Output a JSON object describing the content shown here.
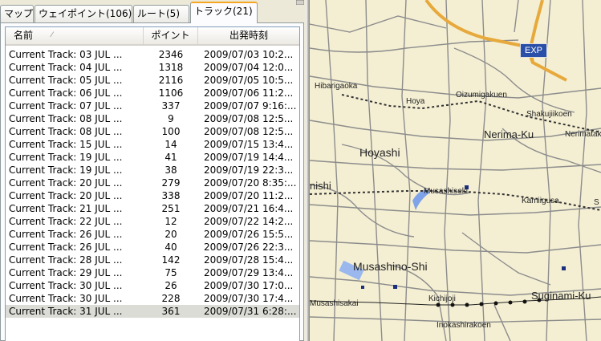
{
  "tabs": [
    {
      "label": "マップ",
      "active": false
    },
    {
      "label": "ウェイポイント(106)",
      "active": false
    },
    {
      "label": "ルート(5)",
      "active": false
    },
    {
      "label": "トラック(21)",
      "active": true
    }
  ],
  "list": {
    "columns": {
      "name": "名前",
      "points": "ポイント",
      "time": "出発時刻"
    },
    "rows": [
      {
        "name": "Current Track: 03 JUL ...",
        "points": "2346",
        "time": "2009/07/03 10:2..."
      },
      {
        "name": "Current Track: 04 JUL ...",
        "points": "1318",
        "time": "2009/07/04 12:0..."
      },
      {
        "name": "Current Track: 05 JUL ...",
        "points": "2116",
        "time": "2009/07/05 10:5..."
      },
      {
        "name": "Current Track: 06 JUL ...",
        "points": "1106",
        "time": "2009/07/06 11:2..."
      },
      {
        "name": "Current Track: 07 JUL ...",
        "points": "337",
        "time": "2009/07/07 9:16:..."
      },
      {
        "name": "Current Track: 08 JUL ...",
        "points": "9",
        "time": "2009/07/08 12:5..."
      },
      {
        "name": "Current Track: 08 JUL ...",
        "points": "100",
        "time": "2009/07/08 12:5..."
      },
      {
        "name": "Current Track: 15 JUL ...",
        "points": "14",
        "time": "2009/07/15 13:4..."
      },
      {
        "name": "Current Track: 19 JUL ...",
        "points": "41",
        "time": "2009/07/19 14:4..."
      },
      {
        "name": "Current Track: 19 JUL ...",
        "points": "38",
        "time": "2009/07/19 22:3..."
      },
      {
        "name": "Current Track: 20 JUL ...",
        "points": "279",
        "time": "2009/07/20 8:35:..."
      },
      {
        "name": "Current Track: 20 JUL ...",
        "points": "338",
        "time": "2009/07/20 11:2..."
      },
      {
        "name": "Current Track: 21 JUL ...",
        "points": "251",
        "time": "2009/07/21 16:4..."
      },
      {
        "name": "Current Track: 22 JUL ...",
        "points": "12",
        "time": "2009/07/22 14:2..."
      },
      {
        "name": "Current Track: 26 JUL ...",
        "points": "20",
        "time": "2009/07/26 15:5..."
      },
      {
        "name": "Current Track: 26 JUL ...",
        "points": "40",
        "time": "2009/07/26 22:3..."
      },
      {
        "name": "Current Track: 28 JUL ...",
        "points": "142",
        "time": "2009/07/28 15:4..."
      },
      {
        "name": "Current Track: 29 JUL ...",
        "points": "75",
        "time": "2009/07/29 13:4..."
      },
      {
        "name": "Current Track: 30 JUL ...",
        "points": "26",
        "time": "2009/07/30 17:0..."
      },
      {
        "name": "Current Track: 30 JUL ...",
        "points": "228",
        "time": "2009/07/30 17:4..."
      },
      {
        "name": "Current Track: 31 JUL ...",
        "points": "361",
        "time": "2009/07/31 6:28:..."
      }
    ],
    "selected_index": 20
  },
  "map": {
    "labels": [
      {
        "id": "hibarigaoka",
        "text": "Hibarigaoka"
      },
      {
        "id": "hoya",
        "text": "Hoya"
      },
      {
        "id": "oizumigakuen",
        "text": "Oizumigakuen"
      },
      {
        "id": "shakujiikoen",
        "text": "Shakujiikoen"
      },
      {
        "id": "nerima-ku",
        "text": "Nerima-Ku"
      },
      {
        "id": "nerimatak",
        "text": "Nerimatak"
      },
      {
        "id": "hoyashi",
        "text": "Hoyashi"
      },
      {
        "id": "nishi",
        "text": "nishi"
      },
      {
        "id": "musashiseki",
        "text": "Musashiseki"
      },
      {
        "id": "kamiigusa",
        "text": "Kamiigusa"
      },
      {
        "id": "musashino-shi",
        "text": "Musashino-Shi"
      },
      {
        "id": "suginami-ku",
        "text": "Suginami-Ku"
      },
      {
        "id": "kichijoji",
        "text": "Kichijoji"
      },
      {
        "id": "musashisakai",
        "text": "Musashisakai"
      },
      {
        "id": "inokashirakoen",
        "text": "Inokashirakoen"
      },
      {
        "id": "s",
        "text": "S"
      }
    ],
    "exp_badge": "EXP",
    "colors": {
      "background": "#f4efd3",
      "road": "#8c8c8c",
      "expressway": "#e7a93b",
      "water": "#7fa3e8",
      "rail": "#333333"
    }
  }
}
